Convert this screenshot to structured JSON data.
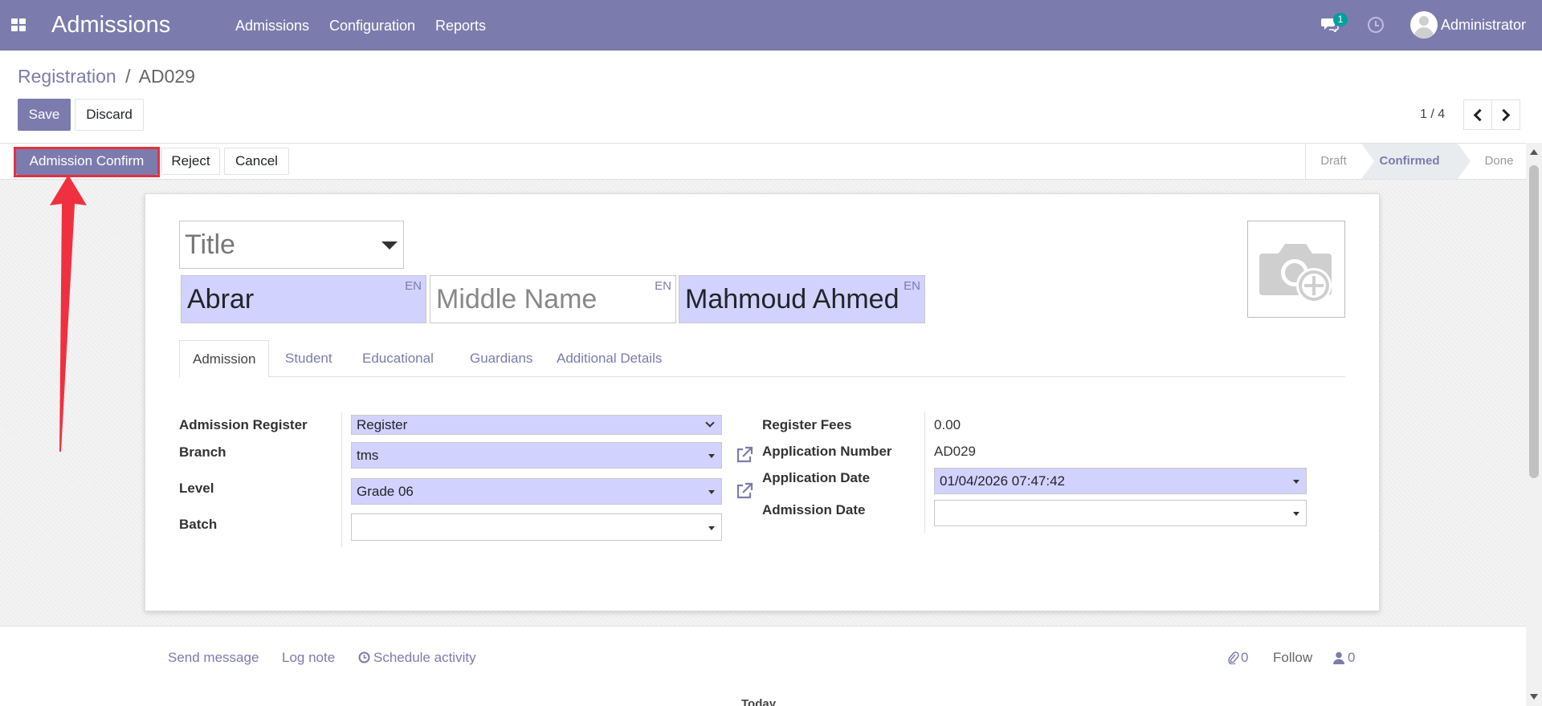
{
  "topbar": {
    "app_title": "Admissions",
    "menus": [
      "Admissions",
      "Configuration",
      "Reports"
    ],
    "message_count": "1",
    "user": "Administrator"
  },
  "breadcrumb": {
    "parent": "Registration",
    "separator": "/",
    "current": "AD029"
  },
  "toolbar": {
    "save": "Save",
    "discard": "Discard"
  },
  "pager": {
    "text": "1 / 4"
  },
  "actions": {
    "confirm": "Admission Confirm",
    "reject": "Reject",
    "cancel": "Cancel"
  },
  "stages": {
    "draft": "Draft",
    "confirmed": "Confirmed",
    "done": "Done",
    "active": "Confirmed"
  },
  "form": {
    "title_placeholder": "Title",
    "first_name": "Abrar",
    "middle_name_placeholder": "Middle Name",
    "last_name": "Mahmoud Ahmed",
    "lang_tag": "EN",
    "photo_icon": "camera-plus-icon"
  },
  "tabs": [
    "Admission",
    "Student",
    "Educational",
    "Guardians",
    "Additional Details"
  ],
  "fields_left": {
    "admission_register": {
      "label": "Admission Register",
      "value": "Register"
    },
    "branch": {
      "label": "Branch",
      "value": "tms"
    },
    "level": {
      "label": "Level",
      "value": "Grade 06"
    },
    "batch": {
      "label": "Batch",
      "value": ""
    }
  },
  "fields_right": {
    "register_fees": {
      "label": "Register Fees",
      "value": "0.00"
    },
    "application_number": {
      "label": "Application Number",
      "value": "AD029"
    },
    "application_date": {
      "label": "Application Date",
      "value": "01/04/2026 07:47:42"
    },
    "admission_date": {
      "label": "Admission Date",
      "value": ""
    }
  },
  "chatter": {
    "send_message": "Send message",
    "log_note": "Log note",
    "schedule_activity": "Schedule activity",
    "attachments": "0",
    "follow": "Follow",
    "followers": "0",
    "today": "Today"
  },
  "colors": {
    "brand": "#7c7bad",
    "required_field": "#d2d2ff",
    "annotation": "#e5303f"
  }
}
